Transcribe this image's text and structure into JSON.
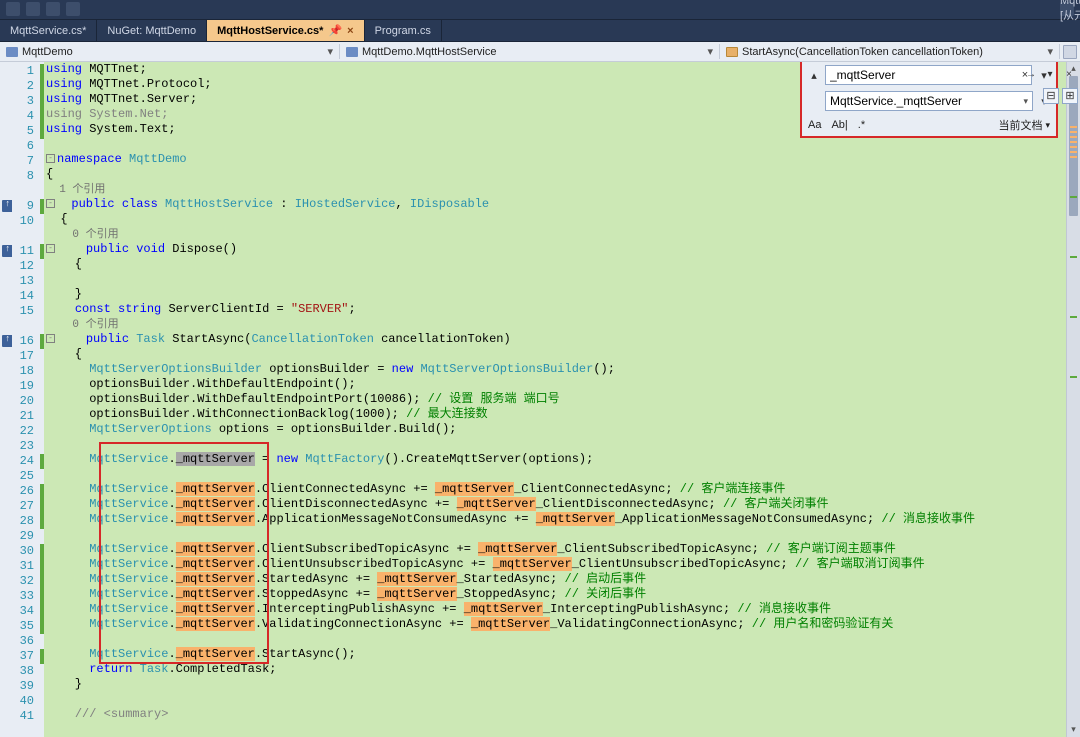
{
  "topbar_label": "MqttServer [从元数据]",
  "tabs": [
    {
      "label": "MqttService.cs*"
    },
    {
      "label": "NuGet: MqttDemo"
    },
    {
      "label": "MqttHostService.cs*",
      "active": true,
      "pinned": true
    },
    {
      "label": "Program.cs"
    }
  ],
  "navbar": {
    "project": "MqttDemo",
    "class": "MqttDemo.MqttHostService",
    "method": "StartAsync(CancellationToken cancellationToken)"
  },
  "find": {
    "search_value": "_mqttServer",
    "replace_value": "MqttService._mqttServer",
    "opt_case": "Aa",
    "opt_word": "Ab|",
    "opt_regex": ".*",
    "scope": "当前文档"
  },
  "code": {
    "lines": [
      {
        "n": 1,
        "i": 0,
        "t": [
          [
            "kw",
            "using"
          ],
          [
            "",
            " MQTTnet;"
          ]
        ]
      },
      {
        "n": 2,
        "i": 0,
        "t": [
          [
            "kw",
            "using"
          ],
          [
            "",
            " MQTTnet.Protocol;"
          ]
        ]
      },
      {
        "n": 3,
        "i": 0,
        "t": [
          [
            "kw",
            "using"
          ],
          [
            "",
            " MQTTnet.Server;"
          ]
        ]
      },
      {
        "n": 4,
        "i": 0,
        "t": [
          [
            "gray-txt",
            "using System.Net;"
          ]
        ]
      },
      {
        "n": 5,
        "i": 0,
        "t": [
          [
            "kw",
            "using"
          ],
          [
            "",
            " System.Text;"
          ]
        ]
      },
      {
        "n": 6,
        "i": 0,
        "t": []
      },
      {
        "n": 7,
        "i": 0,
        "box": "-",
        "t": [
          [
            "kw",
            "namespace"
          ],
          [
            "",
            " "
          ],
          [
            "type",
            "MqttDemo"
          ]
        ]
      },
      {
        "n": 8,
        "i": 0,
        "t": [
          [
            "",
            "{"
          ]
        ]
      },
      {
        "n": "",
        "i": 1,
        "t": [
          [
            "refs",
            "  1 个引用"
          ]
        ]
      },
      {
        "n": 9,
        "i": 1,
        "box": "-",
        "t": [
          [
            "",
            "  "
          ],
          [
            "kw",
            "public"
          ],
          [
            "",
            " "
          ],
          [
            "kw",
            "class"
          ],
          [
            "",
            " "
          ],
          [
            "type",
            "MqttHostService"
          ],
          [
            "",
            " : "
          ],
          [
            "type",
            "IHostedService"
          ],
          [
            "",
            ", "
          ],
          [
            "type",
            "IDisposable"
          ]
        ],
        "ref": true
      },
      {
        "n": 10,
        "i": 1,
        "t": [
          [
            "",
            "  {"
          ]
        ]
      },
      {
        "n": "",
        "i": 2,
        "t": [
          [
            "refs",
            "    0 个引用"
          ]
        ]
      },
      {
        "n": 11,
        "i": 2,
        "box": "-",
        "t": [
          [
            "",
            "    "
          ],
          [
            "kw",
            "public"
          ],
          [
            "",
            " "
          ],
          [
            "kw",
            "void"
          ],
          [
            "",
            " "
          ],
          [
            "",
            "Dispose"
          ],
          [
            "",
            "()"
          ]
        ],
        "ref": true
      },
      {
        "n": 12,
        "i": 2,
        "t": [
          [
            "",
            "    {"
          ]
        ]
      },
      {
        "n": 13,
        "i": 2,
        "t": []
      },
      {
        "n": 14,
        "i": 2,
        "t": [
          [
            "",
            "    }"
          ]
        ]
      },
      {
        "n": 15,
        "i": 2,
        "t": [
          [
            "",
            "    "
          ],
          [
            "kw",
            "const"
          ],
          [
            "",
            " "
          ],
          [
            "kw",
            "string"
          ],
          [
            "",
            " ServerClientId = "
          ],
          [
            "str",
            "\"SERVER\""
          ],
          [
            "",
            ";"
          ]
        ]
      },
      {
        "n": "",
        "i": 2,
        "t": [
          [
            "refs",
            "    0 个引用"
          ]
        ]
      },
      {
        "n": 16,
        "i": 2,
        "box": "-",
        "t": [
          [
            "",
            "    "
          ],
          [
            "kw",
            "public"
          ],
          [
            "",
            " "
          ],
          [
            "type",
            "Task"
          ],
          [
            "",
            " StartAsync("
          ],
          [
            "type",
            "CancellationToken"
          ],
          [
            "",
            " cancellationToken)"
          ]
        ],
        "ref": true
      },
      {
        "n": 17,
        "i": 2,
        "t": [
          [
            "",
            "    {"
          ]
        ]
      },
      {
        "n": 18,
        "i": 3,
        "t": [
          [
            "",
            "      "
          ],
          [
            "type",
            "MqttServerOptionsBuilder"
          ],
          [
            "",
            " optionsBuilder = "
          ],
          [
            "kw",
            "new"
          ],
          [
            "",
            " "
          ],
          [
            "type",
            "MqttServerOptionsBuilder"
          ],
          [
            "",
            "();"
          ]
        ]
      },
      {
        "n": 19,
        "i": 3,
        "t": [
          [
            "",
            "      optionsBuilder.WithDefaultEndpoint();"
          ]
        ]
      },
      {
        "n": 20,
        "i": 3,
        "t": [
          [
            "",
            "      optionsBuilder.WithDefaultEndpointPort(10086); "
          ],
          [
            "comment",
            "// 设置 服务端 端口号"
          ]
        ]
      },
      {
        "n": 21,
        "i": 3,
        "t": [
          [
            "",
            "      optionsBuilder.WithConnectionBacklog(1000); "
          ],
          [
            "comment",
            "// 最大连接数"
          ]
        ]
      },
      {
        "n": 22,
        "i": 3,
        "t": [
          [
            "",
            "      "
          ],
          [
            "type",
            "MqttServerOptions"
          ],
          [
            "",
            " options = optionsBuilder.Build();"
          ]
        ]
      },
      {
        "n": 23,
        "i": 3,
        "t": []
      },
      {
        "n": 24,
        "i": 3,
        "t": [
          [
            "",
            "      "
          ],
          [
            "type",
            "MqttService"
          ],
          [
            "",
            "."
          ],
          [
            "hl-cursor",
            "_mqttServer"
          ],
          [
            "",
            " = "
          ],
          [
            "kw",
            "new"
          ],
          [
            "",
            " "
          ],
          [
            "type",
            "MqttFactory"
          ],
          [
            "",
            "().CreateMqttServer(options);"
          ]
        ],
        "cursor": true
      },
      {
        "n": 25,
        "i": 3,
        "t": []
      },
      {
        "n": 26,
        "i": 3,
        "t": [
          [
            "",
            "      "
          ],
          [
            "type",
            "MqttService"
          ],
          [
            "",
            "."
          ],
          [
            "hl-orange",
            "_mqttServer"
          ],
          [
            "",
            ".ClientConnectedAsync += "
          ],
          [
            "hl-orange",
            "_mqttServer"
          ],
          [
            "",
            "_ClientConnectedAsync; "
          ],
          [
            "comment",
            "// 客户端连接事件"
          ]
        ]
      },
      {
        "n": 27,
        "i": 3,
        "t": [
          [
            "",
            "      "
          ],
          [
            "type",
            "MqttService"
          ],
          [
            "",
            "."
          ],
          [
            "hl-orange",
            "_mqttServer"
          ],
          [
            "",
            ".ClientDisconnectedAsync += "
          ],
          [
            "hl-orange",
            "_mqttServer"
          ],
          [
            "",
            "_ClientDisconnectedAsync; "
          ],
          [
            "comment",
            "// 客户端关闭事件"
          ]
        ]
      },
      {
        "n": 28,
        "i": 3,
        "t": [
          [
            "",
            "      "
          ],
          [
            "type",
            "MqttService"
          ],
          [
            "",
            "."
          ],
          [
            "hl-orange",
            "_mqttServer"
          ],
          [
            "",
            ".ApplicationMessageNotConsumedAsync += "
          ],
          [
            "hl-orange",
            "_mqttServer"
          ],
          [
            "",
            "_ApplicationMessageNotConsumedAsync; "
          ],
          [
            "comment",
            "// 消息接收事件"
          ]
        ]
      },
      {
        "n": 29,
        "i": 3,
        "t": []
      },
      {
        "n": 30,
        "i": 3,
        "t": [
          [
            "",
            "      "
          ],
          [
            "type",
            "MqttService"
          ],
          [
            "",
            "."
          ],
          [
            "hl-orange",
            "_mqttServer"
          ],
          [
            "",
            ".ClientSubscribedTopicAsync += "
          ],
          [
            "hl-orange",
            "_mqttServer"
          ],
          [
            "",
            "_ClientSubscribedTopicAsync; "
          ],
          [
            "comment",
            "// 客户端订阅主题事件"
          ]
        ]
      },
      {
        "n": 31,
        "i": 3,
        "t": [
          [
            "",
            "      "
          ],
          [
            "type",
            "MqttService"
          ],
          [
            "",
            "."
          ],
          [
            "hl-orange",
            "_mqttServer"
          ],
          [
            "",
            ".ClientUnsubscribedTopicAsync += "
          ],
          [
            "hl-orange",
            "_mqttServer"
          ],
          [
            "",
            "_ClientUnsubscribedTopicAsync; "
          ],
          [
            "comment",
            "// 客户端取消订阅事件"
          ]
        ]
      },
      {
        "n": 32,
        "i": 3,
        "t": [
          [
            "",
            "      "
          ],
          [
            "type",
            "MqttService"
          ],
          [
            "",
            "."
          ],
          [
            "hl-orange",
            "_mqttServer"
          ],
          [
            "",
            ".StartedAsync += "
          ],
          [
            "hl-orange",
            "_mqttServer"
          ],
          [
            "",
            "_StartedAsync; "
          ],
          [
            "comment",
            "// 启动后事件"
          ]
        ]
      },
      {
        "n": 33,
        "i": 3,
        "t": [
          [
            "",
            "      "
          ],
          [
            "type",
            "MqttService"
          ],
          [
            "",
            "."
          ],
          [
            "hl-orange",
            "_mqttServer"
          ],
          [
            "",
            ".StoppedAsync += "
          ],
          [
            "hl-orange",
            "_mqttServer"
          ],
          [
            "",
            "_StoppedAsync; "
          ],
          [
            "comment",
            "// 关闭后事件"
          ]
        ]
      },
      {
        "n": 34,
        "i": 3,
        "t": [
          [
            "",
            "      "
          ],
          [
            "type",
            "MqttService"
          ],
          [
            "",
            "."
          ],
          [
            "hl-orange",
            "_mqttServer"
          ],
          [
            "",
            ".InterceptingPublishAsync += "
          ],
          [
            "hl-orange",
            "_mqttServer"
          ],
          [
            "",
            "_InterceptingPublishAsync; "
          ],
          [
            "comment",
            "// 消息接收事件"
          ]
        ]
      },
      {
        "n": 35,
        "i": 3,
        "t": [
          [
            "",
            "      "
          ],
          [
            "type",
            "MqttService"
          ],
          [
            "",
            "."
          ],
          [
            "hl-orange",
            "_mqttServer"
          ],
          [
            "",
            ".ValidatingConnectionAsync += "
          ],
          [
            "hl-orange",
            "_mqttServer"
          ],
          [
            "",
            "_ValidatingConnectionAsync; "
          ],
          [
            "comment",
            "// 用户名和密码验证有关"
          ]
        ]
      },
      {
        "n": 36,
        "i": 3,
        "t": []
      },
      {
        "n": 37,
        "i": 3,
        "t": [
          [
            "",
            "      "
          ],
          [
            "type",
            "MqttService"
          ],
          [
            "",
            "."
          ],
          [
            "hl-orange",
            "_mqttServer"
          ],
          [
            "",
            ".StartAsync();"
          ]
        ]
      },
      {
        "n": 38,
        "i": 3,
        "t": [
          [
            "",
            "      "
          ],
          [
            "kw",
            "return"
          ],
          [
            "",
            " "
          ],
          [
            "type",
            "Task"
          ],
          [
            "",
            ".CompletedTask;"
          ]
        ]
      },
      {
        "n": 39,
        "i": 2,
        "t": [
          [
            "",
            "    }"
          ]
        ]
      },
      {
        "n": 40,
        "i": 2,
        "t": []
      },
      {
        "n": 41,
        "i": 2,
        "t": [
          [
            "",
            "    "
          ],
          [
            "gray-txt",
            "/// <summary>"
          ]
        ]
      }
    ]
  }
}
